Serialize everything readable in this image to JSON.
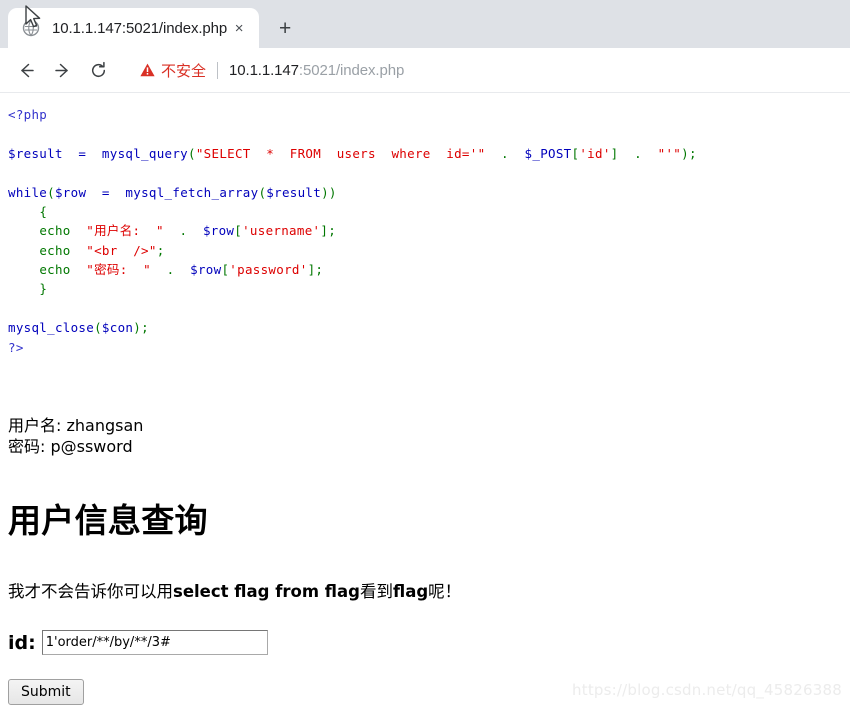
{
  "browser": {
    "tab": {
      "title": "10.1.1.147:5021/index.php",
      "close_label": "×",
      "favicon_name": "page-favicon"
    },
    "newtab_label": "+",
    "toolbar": {
      "back_label": "←",
      "forward_label": "→",
      "reload_label": "⟳",
      "security_text": "不安全",
      "url_host": "10.1.1.147",
      "url_path": ":5021/index.php",
      "url_full": "10.1.1.147:5021/index.php"
    }
  },
  "code": {
    "open_tag": "<?php",
    "line_query": {
      "var": "$result",
      "eq": "  =  ",
      "fn": "mysql_query",
      "open": "(",
      "str1": "\"SELECT  *  FROM  users  where  id='\"",
      "dot1": "  .  ",
      "post_var": "$_POST",
      "bracket_open": "[",
      "post_key": "'id'",
      "bracket_close": "]",
      "dot2": "  .  ",
      "str2": "\"'\"",
      "close": ")",
      "semi": ";"
    },
    "line_while": {
      "kw": "while",
      "open": "(",
      "var": "$row",
      "eq": "  =  ",
      "fn": "mysql_fetch_array",
      "open2": "(",
      "var2": "$result",
      "close": "))"
    },
    "brace_open": "{",
    "echo1": {
      "kw": "echo",
      "str": "\"用户名:  \"",
      "dot": "  .  ",
      "var": "$row",
      "bracket_open": "[",
      "key": "'username'",
      "bracket_close": "]",
      "semi": ";"
    },
    "echo2": {
      "kw": "echo",
      "str": "\"<br  />\"",
      "semi": ";"
    },
    "echo3": {
      "kw": "echo",
      "str": "\"密码:  \"",
      "dot": "  .  ",
      "var": "$row",
      "bracket_open": "[",
      "key": "'password'",
      "bracket_close": "]",
      "semi": ";"
    },
    "brace_close": "}",
    "line_close": {
      "fn": "mysql_close",
      "open": "(",
      "var": "$con",
      "close": ")",
      "semi": ";"
    },
    "end_tag": "?>"
  },
  "output": {
    "username_line": "用户名: zhangsan",
    "password_line": "密码: p@ssword"
  },
  "main": {
    "heading": "用户信息查询",
    "hint_prefix": "我才不会告诉你可以用",
    "hint_bold": "select flag from flag",
    "hint_mid": "看到",
    "hint_bold2": "flag",
    "hint_suffix": "呢！",
    "id_label": "id:",
    "id_value": "1'order/**/by/**/3#",
    "id_placeholder": "",
    "submit_label": "Submit"
  },
  "watermark": "https://blog.csdn.net/qq_45826388",
  "colors": {
    "code_tag": "#3333cc",
    "code_keyword": "#0000bb",
    "code_string": "#dd0000",
    "code_punct": "#007700",
    "not_secure": "#d93025",
    "chrome_bg": "#dee1e6"
  }
}
